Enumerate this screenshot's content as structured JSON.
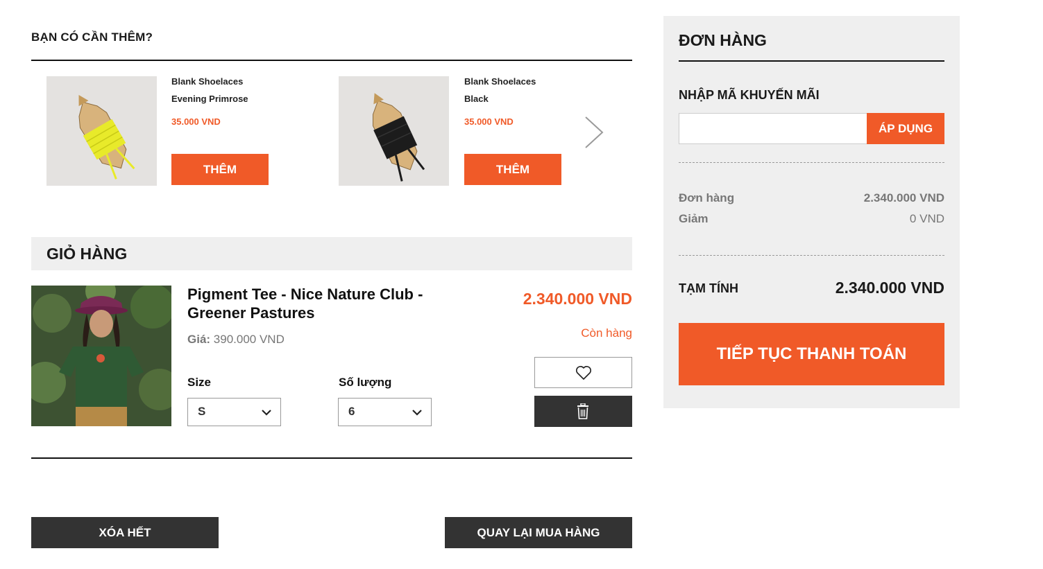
{
  "suggestions": {
    "title": "BẠN CÓ CẦN THÊM?",
    "items": [
      {
        "name_line1": "Blank Shoelaces",
        "name_line2": "Evening Primrose",
        "price": "35.000 VND",
        "add_label": "THÊM",
        "lace_color": "#e8ea2a"
      },
      {
        "name_line1": "Blank Shoelaces",
        "name_line2": "Black",
        "price": "35.000 VND",
        "add_label": "THÊM",
        "lace_color": "#1c1c1c"
      }
    ]
  },
  "cart": {
    "title": "GIỎ HÀNG",
    "item": {
      "name": "Pigment Tee - Nice Nature Club - Greener Pastures",
      "unit_price_label": "Giá:",
      "unit_price": "390.000 VND",
      "total": "2.340.000 VND",
      "stock": "Còn hàng",
      "size_label": "Size",
      "size_value": "S",
      "qty_label": "Số lượng",
      "qty_value": "6"
    },
    "clear_all_label": "XÓA HẾT",
    "back_label": "QUAY LẠI MUA HÀNG"
  },
  "order": {
    "title": "ĐƠN HÀNG",
    "promo_label": "NHẬP MÃ KHUYẾN MÃI",
    "promo_placeholder": "",
    "apply_label": "ÁP DỤNG",
    "order_label": "Đơn hàng",
    "order_value": "2.340.000 VND",
    "discount_label": "Giảm",
    "discount_value": "0 VND",
    "subtotal_label": "TẠM TÍNH",
    "subtotal_value": "2.340.000 VND",
    "checkout_label": "TIẾP TỤC THANH TOÁN"
  },
  "colors": {
    "accent": "#f05a28",
    "dark": "#333333",
    "panel": "#efefef"
  }
}
